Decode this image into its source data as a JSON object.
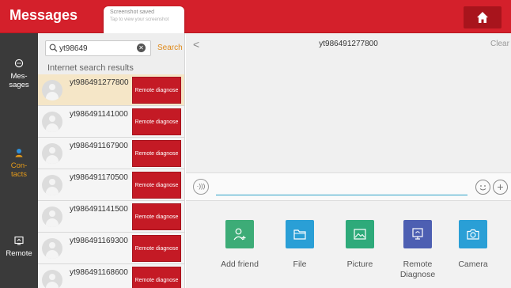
{
  "header": {
    "title": "Messages",
    "home_icon": "home-icon"
  },
  "toast": {
    "line1": "Screenshot saved",
    "line2": "Tap to view your screenshot"
  },
  "nav": {
    "items": [
      {
        "label1": "Mes-",
        "label2": "sages",
        "icon": "chat-bubble-icon",
        "active": false
      },
      {
        "label1": "Con-",
        "label2": "tacts",
        "icon": "contacts-icon",
        "active": true
      },
      {
        "label1": "Remote",
        "label2": "",
        "icon": "remote-icon",
        "active": false
      }
    ]
  },
  "search": {
    "value": "yt98649",
    "placeholder": "",
    "button_label": "Search"
  },
  "results": {
    "title": "Internet search results",
    "button_label": "Remote diagnose",
    "rows": [
      {
        "name": "yt986491277800",
        "highlighted": true
      },
      {
        "name": "yt986491141000",
        "highlighted": false
      },
      {
        "name": "yt986491167900",
        "highlighted": false
      },
      {
        "name": "yt986491170500",
        "highlighted": false
      },
      {
        "name": "yt986491141500",
        "highlighted": false
      },
      {
        "name": "yt986491169300",
        "highlighted": false
      },
      {
        "name": "yt986491168600",
        "highlighted": false
      }
    ]
  },
  "chat": {
    "contact_name": "yt986491277800",
    "clear_label": "Clear",
    "input_value": "",
    "input_placeholder": ""
  },
  "actions": [
    {
      "label": "Add friend",
      "icon": "add-friend-icon",
      "color": "#3dac77"
    },
    {
      "label": "File",
      "icon": "folder-icon",
      "color": "#2a9fd6"
    },
    {
      "label": "Picture",
      "icon": "picture-icon",
      "color": "#2eaa7a"
    },
    {
      "label": "Remote Diagnose",
      "icon": "remote-diagnose-icon",
      "color": "#4d5fb2"
    },
    {
      "label": "Camera",
      "icon": "camera-icon",
      "color": "#2a9fd6"
    }
  ],
  "colors": {
    "brand_red": "#d4202b",
    "accent_orange": "#e08a1a",
    "button_red": "#c41a25"
  }
}
